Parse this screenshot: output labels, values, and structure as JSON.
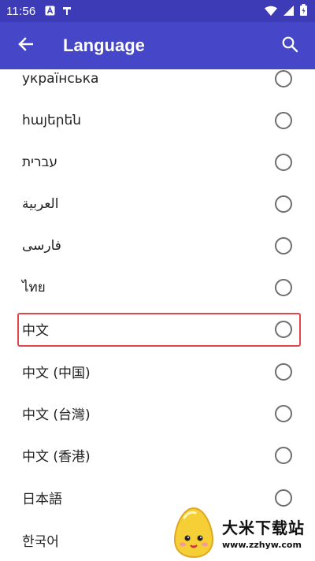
{
  "status_bar": {
    "time": "11:56"
  },
  "app_bar": {
    "title": "Language"
  },
  "languages": [
    {
      "label": "українська",
      "selected": false
    },
    {
      "label": "հայերեն",
      "selected": false
    },
    {
      "label": "עברית",
      "selected": false
    },
    {
      "label": "العربية",
      "selected": false
    },
    {
      "label": "فارسی",
      "selected": false
    },
    {
      "label": "ไทย",
      "selected": false
    },
    {
      "label": "中文",
      "selected": false,
      "highlighted": true
    },
    {
      "label": "中文 (中国)",
      "selected": false
    },
    {
      "label": "中文 (台灣)",
      "selected": false
    },
    {
      "label": "中文 (香港)",
      "selected": false
    },
    {
      "label": "日本語",
      "selected": false
    },
    {
      "label": "한국어",
      "selected": false
    }
  ],
  "watermark": {
    "title": "大米下载站",
    "url": "www.zzhyw.com"
  },
  "colors": {
    "status_bar": "#3d3bb5",
    "app_bar": "#4646c9",
    "highlight": "#e0464a"
  }
}
